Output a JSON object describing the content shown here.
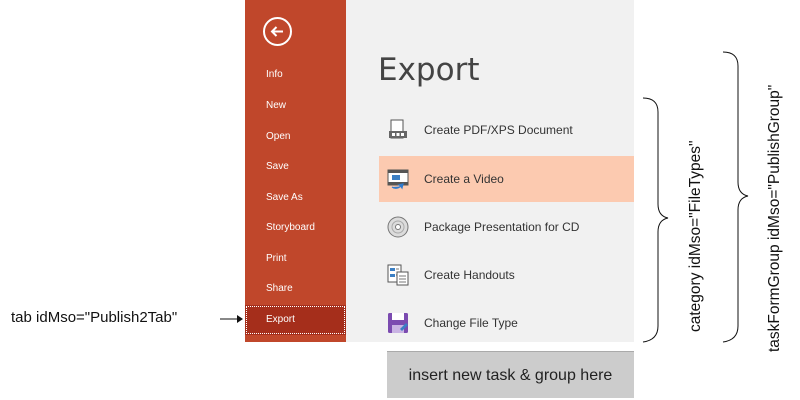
{
  "sidebar": {
    "back_icon": "back-arrow-icon",
    "items": [
      {
        "label": "Info"
      },
      {
        "label": "New"
      },
      {
        "label": "Open"
      },
      {
        "label": "Save"
      },
      {
        "label": "Save As"
      },
      {
        "label": "Storyboard"
      },
      {
        "label": "Print"
      },
      {
        "label": "Share"
      },
      {
        "label": "Export",
        "selected": true
      }
    ]
  },
  "main": {
    "title": "Export",
    "tasks": [
      {
        "label": "Create PDF/XPS Document",
        "icon": "pdf-document-icon"
      },
      {
        "label": "Create a Video",
        "icon": "video-icon",
        "selected": true
      },
      {
        "label": "Package Presentation for CD",
        "icon": "cd-icon"
      },
      {
        "label": "Create Handouts",
        "icon": "handouts-icon"
      },
      {
        "label": "Change File Type",
        "icon": "file-type-icon"
      }
    ]
  },
  "annotations": {
    "tab": "tab idMso=\"Publish2Tab\"",
    "category": "category idMso=\"FileTypes\"",
    "task_form_group": "taskFormGroup  idMso=\"PublishGroup\"",
    "insert_hint": "insert new task & group here"
  },
  "colors": {
    "sidebar_bg": "#c0472b",
    "sidebar_selected": "#a52e1b",
    "main_bg": "#f1f1f1",
    "task_selected": "#fccab0",
    "insert_box": "#cccccc"
  }
}
